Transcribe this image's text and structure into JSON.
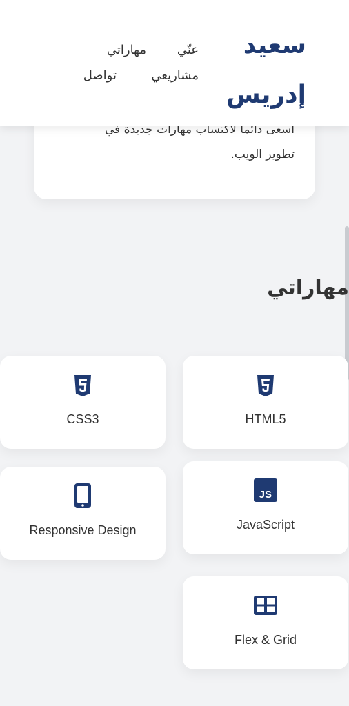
{
  "header": {
    "logo_line1": "سعيد",
    "logo_line2": "إدريس",
    "nav": {
      "about": "عنّي",
      "skills": "مهاراتي",
      "projects": "مشاريعي",
      "contact": "تواصل"
    }
  },
  "about": {
    "text_line1": "أسعى دائما لاكتساب مهارات جديدة في",
    "text_line2": "تطوير الويب."
  },
  "skills_section": {
    "title": "مهاراتي",
    "items": [
      {
        "label": "HTML5",
        "icon": "html5-icon"
      },
      {
        "label": "CSS3",
        "icon": "css3-icon"
      },
      {
        "label": "JavaScript",
        "icon": "javascript-icon"
      },
      {
        "label": "Responsive Design",
        "icon": "mobile-icon"
      },
      {
        "label": "Flex & Grid",
        "icon": "grid-icon"
      }
    ]
  },
  "colors": {
    "brand": "#1f3a72",
    "background": "#f2f3f5",
    "card": "#ffffff",
    "text": "#333333"
  }
}
